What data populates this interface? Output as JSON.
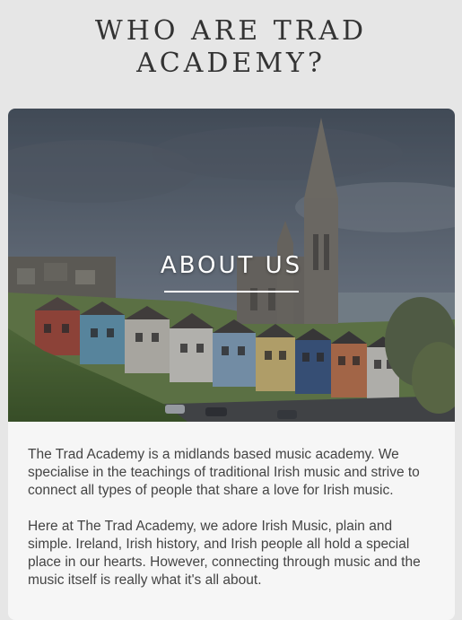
{
  "page": {
    "title_line1": "WHO ARE TRAD",
    "title_line2": "ACADEMY?"
  },
  "hero": {
    "heading": "ABOUT US",
    "image_alt": "Colorful houses below a cathedral spire by the harbour"
  },
  "about": {
    "paragraph_1": "The Trad Academy is a midlands based music academy. We specialise in the teachings of traditional Irish music and strive to connect all types of people that share a love for Irish music.",
    "paragraph_2": "Here at The Trad Academy, we adore Irish Music, plain and simple. Ireland, Irish history, and Irish people all hold a special place in our hearts. However, connecting through music and the music itself is really what it's all about."
  },
  "colors": {
    "page_background": "#e6e6e6",
    "card_background": "#f6f6f6",
    "title_text": "#333333",
    "body_text": "#444444"
  }
}
